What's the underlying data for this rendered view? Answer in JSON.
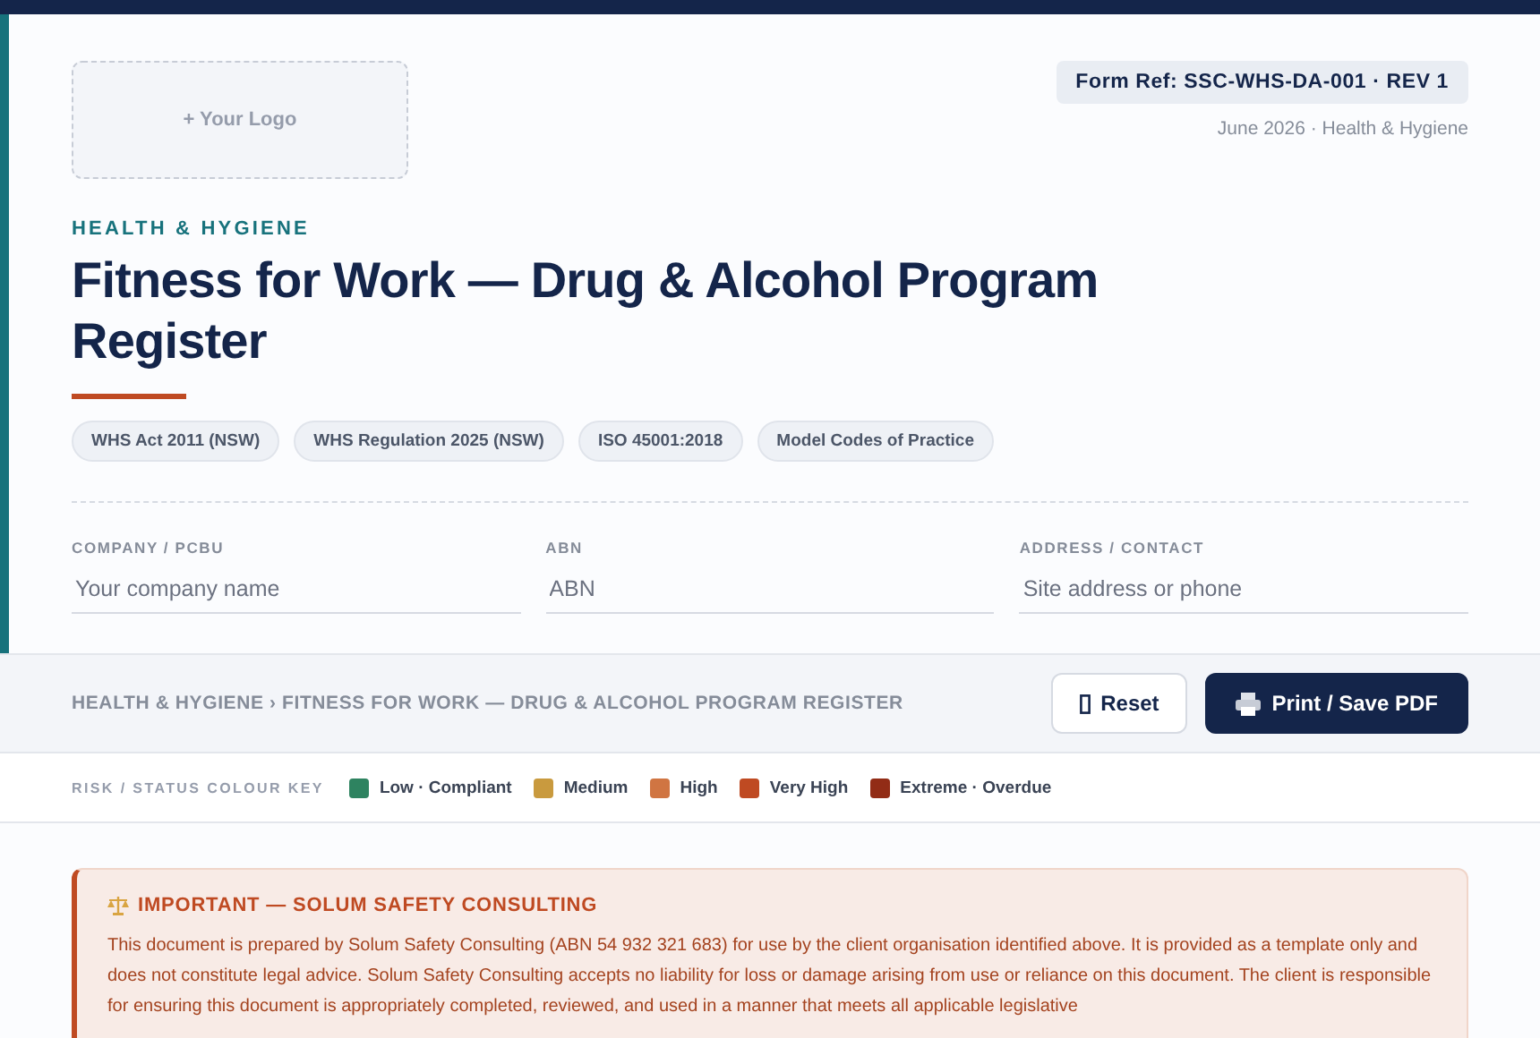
{
  "logo": {
    "label": "+ Your Logo"
  },
  "form_ref": "Form Ref: SSC-WHS-DA-001 · REV 1",
  "form_meta": "June 2026 · Health & Hygiene",
  "category": "HEALTH & HYGIENE",
  "title": "Fitness for Work — Drug & Alcohol Program Register",
  "tags": [
    "WHS Act 2011 (NSW)",
    "WHS Regulation 2025 (NSW)",
    "ISO 45001:2018",
    "Model Codes of Practice"
  ],
  "fields": [
    {
      "label": "COMPANY / PCBU",
      "placeholder": "Your company name"
    },
    {
      "label": "ABN",
      "placeholder": "ABN"
    },
    {
      "label": "ADDRESS / CONTACT",
      "placeholder": "Site address or phone"
    }
  ],
  "breadcrumb": "HEALTH & HYGIENE › FITNESS FOR WORK — DRUG & ALCOHOL PROGRAM REGISTER",
  "buttons": [
    {
      "kind": "reset",
      "label": "Reset"
    },
    {
      "kind": "print",
      "label": "Print / Save PDF"
    }
  ],
  "colour_key": {
    "title": "RISK / STATUS COLOUR KEY",
    "items": [
      {
        "label": "Low · Compliant",
        "color": "#2e8360"
      },
      {
        "label": "Medium",
        "color": "#c99a3e"
      },
      {
        "label": "High",
        "color": "#d07542"
      },
      {
        "label": "Very High",
        "color": "#bf4a22"
      },
      {
        "label": "Extreme · Overdue",
        "color": "#922c16"
      }
    ]
  },
  "notice": {
    "title": "IMPORTANT — SOLUM SAFETY CONSULTING",
    "text": "This document is prepared by Solum Safety Consulting (ABN 54 932 321 683) for use by the client organisation identified above. It is provided as a template only and does not constitute legal advice. Solum Safety Consulting accepts no liability for loss or damage arising from use or reliance on this document. The client is responsible for ensuring this document is appropriately completed, reviewed, and used in a manner that meets all applicable legislative"
  }
}
